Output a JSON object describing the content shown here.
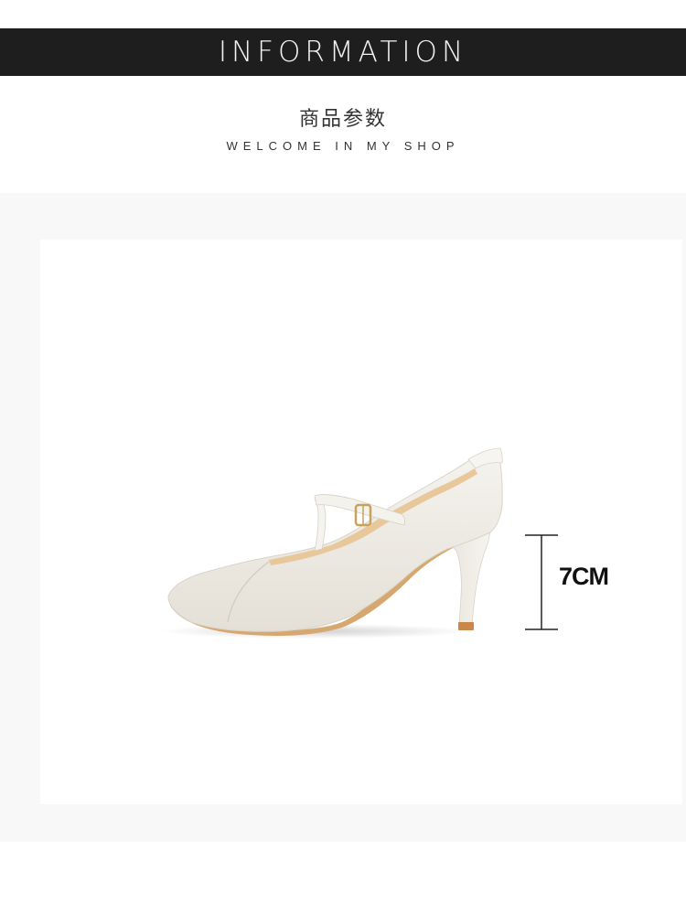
{
  "header": {
    "title": "INFORMATION"
  },
  "section": {
    "title_cn": "商品参数",
    "subtitle_en": "WELCOME IN MY SHOP"
  },
  "product": {
    "image": "white-pointed-toe-t-strap-heel-shoe",
    "heel_height_label": "7CM"
  },
  "colors": {
    "banner_bg": "#1e1e1e",
    "banner_text": "#f2f2f2",
    "section_bg": "#f8f8f8",
    "shoe_white": "#f1eee8",
    "lining": "#d9a96e"
  }
}
